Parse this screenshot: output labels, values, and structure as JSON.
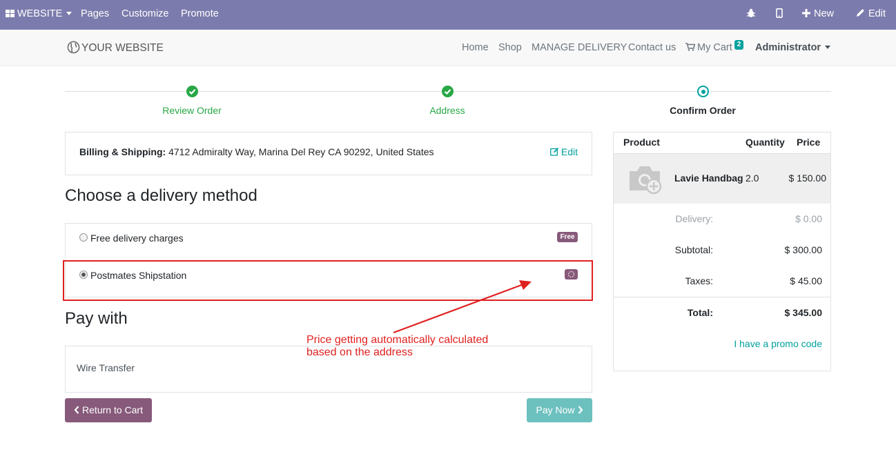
{
  "admin_bar": {
    "website_label": "WEBSITE",
    "menu": [
      "Pages",
      "Customize",
      "Promote"
    ],
    "new_label": "New",
    "edit_label": "Edit"
  },
  "site_header": {
    "logo_text": "YOUR WEBSITE",
    "nav": [
      "Home",
      "Shop",
      "MANAGE DELIVERY",
      "Contact us"
    ],
    "cart_label": "My Cart",
    "cart_count": "2",
    "user_label": "Administrator"
  },
  "steps": [
    {
      "label": "Review Order",
      "state": "done"
    },
    {
      "label": "Address",
      "state": "done"
    },
    {
      "label": "Confirm Order",
      "state": "current"
    }
  ],
  "billing": {
    "label": "Billing & Shipping:",
    "address": "4712 Admiralty Way, Marina Del Rey CA 90292, United States",
    "edit_label": "Edit"
  },
  "delivery": {
    "heading": "Choose a delivery method",
    "options": [
      {
        "label": "Free delivery charges",
        "badge": "Free",
        "selected": false
      },
      {
        "label": "Postmates Shipstation",
        "badge": "",
        "selected": true,
        "loading": true
      }
    ]
  },
  "payment": {
    "heading": "Pay with",
    "method": "Wire Transfer"
  },
  "buttons": {
    "return_label": "Return to Cart",
    "pay_label": "Pay Now"
  },
  "annotation": {
    "line1": "Price getting automatically calculated",
    "line2": "based on the address",
    "color": "#e02020"
  },
  "cart_summary": {
    "headers": {
      "product": "Product",
      "quantity": "Quantity",
      "price": "Price"
    },
    "items": [
      {
        "name": "Lavie Handbag",
        "quantity": "2.0",
        "price": "$ 150.00"
      }
    ],
    "delivery_label": "Delivery:",
    "delivery_value": "$ 0.00",
    "subtotal_label": "Subtotal:",
    "subtotal_value": "$ 300.00",
    "taxes_label": "Taxes:",
    "taxes_value": "$ 45.00",
    "total_label": "Total:",
    "total_value": "$ 345.00",
    "promo_label": "I have a promo code"
  },
  "colors": {
    "admin_bar": "#7c7bad",
    "primary": "#875a7b",
    "accent": "#00a09d",
    "success": "#28a745"
  }
}
